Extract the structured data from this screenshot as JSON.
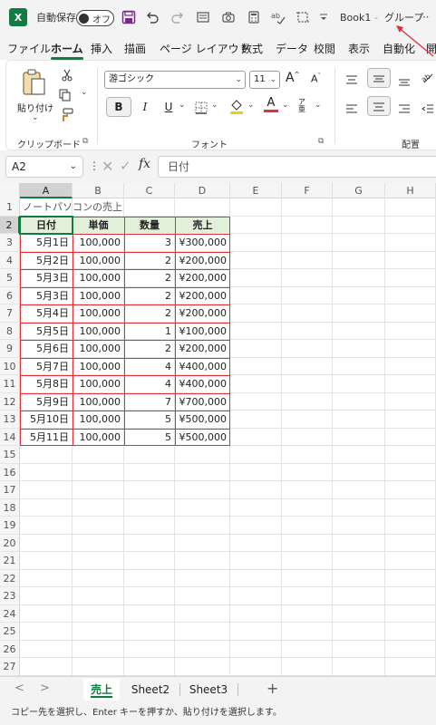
{
  "titlebar": {
    "app_badge": "X",
    "autosave_label": "自動保存",
    "toggle_label": "オフ",
    "filename": "Book1",
    "dash": "-",
    "group_label": "グループ",
    "more": "···"
  },
  "menu_tabs": [
    "ファイル",
    "ホーム",
    "挿入",
    "描画",
    "ページ レイアウト",
    "数式",
    "データ",
    "校閲",
    "表示",
    "自動化",
    "開"
  ],
  "active_tab": "ホーム",
  "ribbon": {
    "paste_label": "貼り付け",
    "clipboard_caption": "クリップボード",
    "font_caption": "フォント",
    "alignment_caption": "配置",
    "font_name": "游ゴシック",
    "font_size": "11",
    "bold": "B",
    "italic": "I",
    "underline": "U",
    "grow_font": "A",
    "shrink_font": "A",
    "font_color_letter": "A",
    "phonetic": "ア亜",
    "accent_fill": "#f5d000",
    "accent_font": "#e0313b"
  },
  "formula_bar": {
    "name_box": "A2",
    "fx": "fx",
    "content": "日付"
  },
  "columns": [
    "A",
    "B",
    "C",
    "D",
    "E",
    "F",
    "G",
    "H"
  ],
  "rows": [
    "1",
    "2",
    "3",
    "4",
    "5",
    "6",
    "7",
    "8",
    "9",
    "10",
    "11",
    "12",
    "13",
    "14",
    "15",
    "16",
    "17",
    "18",
    "19",
    "20",
    "21",
    "22",
    "23",
    "24",
    "25",
    "26",
    "27"
  ],
  "sheet": {
    "title": "ノートパソコンの売上",
    "headers": [
      "日付",
      "単価",
      "数量",
      "売上"
    ],
    "data": [
      [
        "5月1日",
        "100,000",
        "3",
        "¥300,000"
      ],
      [
        "5月2日",
        "100,000",
        "2",
        "¥200,000"
      ],
      [
        "5月3日",
        "100,000",
        "2",
        "¥200,000"
      ],
      [
        "5月3日",
        "100,000",
        "2",
        "¥200,000"
      ],
      [
        "5月4日",
        "100,000",
        "2",
        "¥200,000"
      ],
      [
        "5月5日",
        "100,000",
        "1",
        "¥100,000"
      ],
      [
        "5月6日",
        "100,000",
        "2",
        "¥200,000"
      ],
      [
        "5月7日",
        "100,000",
        "4",
        "¥400,000"
      ],
      [
        "5月8日",
        "100,000",
        "4",
        "¥400,000"
      ],
      [
        "5月9日",
        "100,000",
        "7",
        "¥700,000"
      ],
      [
        "5月10日",
        "100,000",
        "5",
        "¥500,000"
      ],
      [
        "5月11日",
        "100,000",
        "5",
        "¥500,000"
      ]
    ],
    "header_fill": "#e2efda",
    "highlight_border": "#e0313b",
    "selection_color": "#107c41"
  },
  "sheet_tabs": [
    "売上",
    "Sheet2",
    "Sheet3"
  ],
  "active_sheet": "売上",
  "add_sheet": "+",
  "nav": {
    "prev": "<",
    "next": ">"
  },
  "status": "コピー先を選択し、Enter キーを押すか、貼り付けを選択します。"
}
